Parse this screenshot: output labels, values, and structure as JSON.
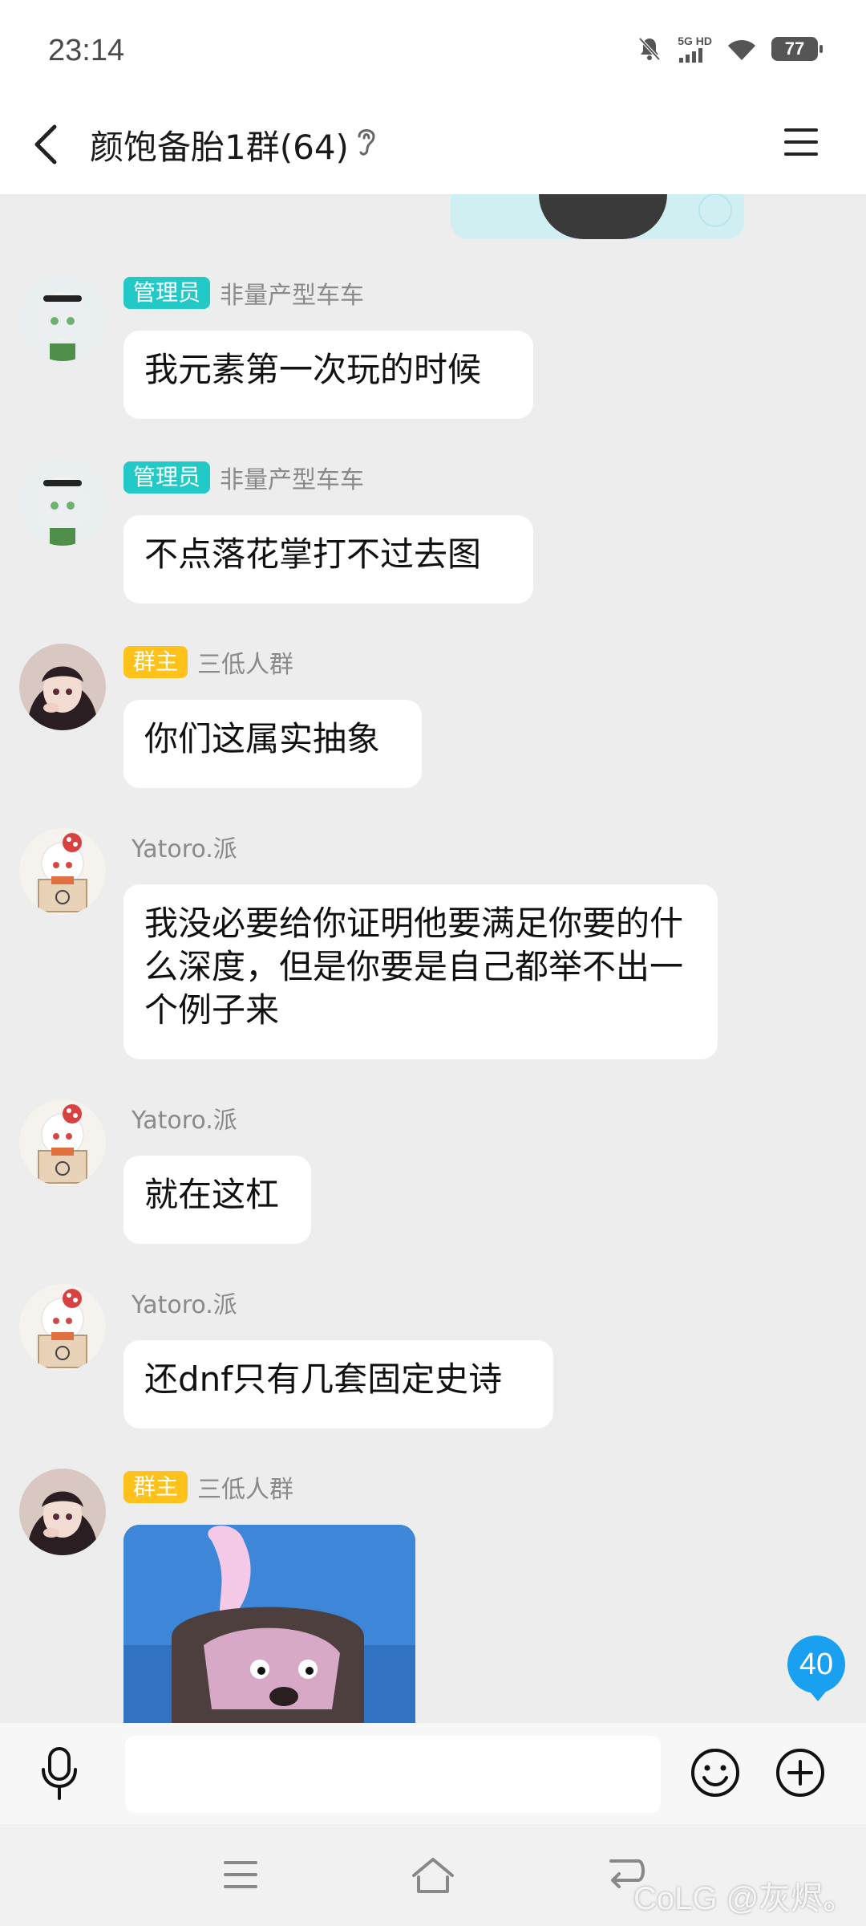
{
  "status_bar": {
    "time": "23:14",
    "network": "5G HD",
    "battery": "77"
  },
  "header": {
    "title": "颜饱备胎1群(64)"
  },
  "messages": [
    {
      "badge": "管理员",
      "badge_type": "admin",
      "nickname": "非量产型车车",
      "text": "我元素第一次玩的时候"
    },
    {
      "badge": "管理员",
      "badge_type": "admin",
      "nickname": "非量产型车车",
      "text": "不点落花掌打不过去图"
    },
    {
      "badge": "群主",
      "badge_type": "owner",
      "nickname": "三低人群",
      "text": "你们这属实抽象"
    },
    {
      "badge": "",
      "badge_type": "none",
      "nickname": "Yatoro.派",
      "text": "我没必要给你证明他要满足你要的什么深度，但是你要是自己都举不出一个例子来"
    },
    {
      "badge": "",
      "badge_type": "none",
      "nickname": "Yatoro.派",
      "text": "就在这杠"
    },
    {
      "badge": "",
      "badge_type": "none",
      "nickname": "Yatoro.派",
      "text": "还dnf只有几套固定史诗"
    },
    {
      "badge": "群主",
      "badge_type": "owner",
      "nickname": "三低人群",
      "text": ""
    }
  ],
  "unread_count": "40",
  "input": {
    "placeholder": ""
  },
  "watermark": "CoLG @灰烬。",
  "colors": {
    "admin_badge": "#22c9c6",
    "owner_badge": "#ffc21a",
    "unread_badge": "#1aa0f0",
    "chat_bg": "#ededed"
  }
}
